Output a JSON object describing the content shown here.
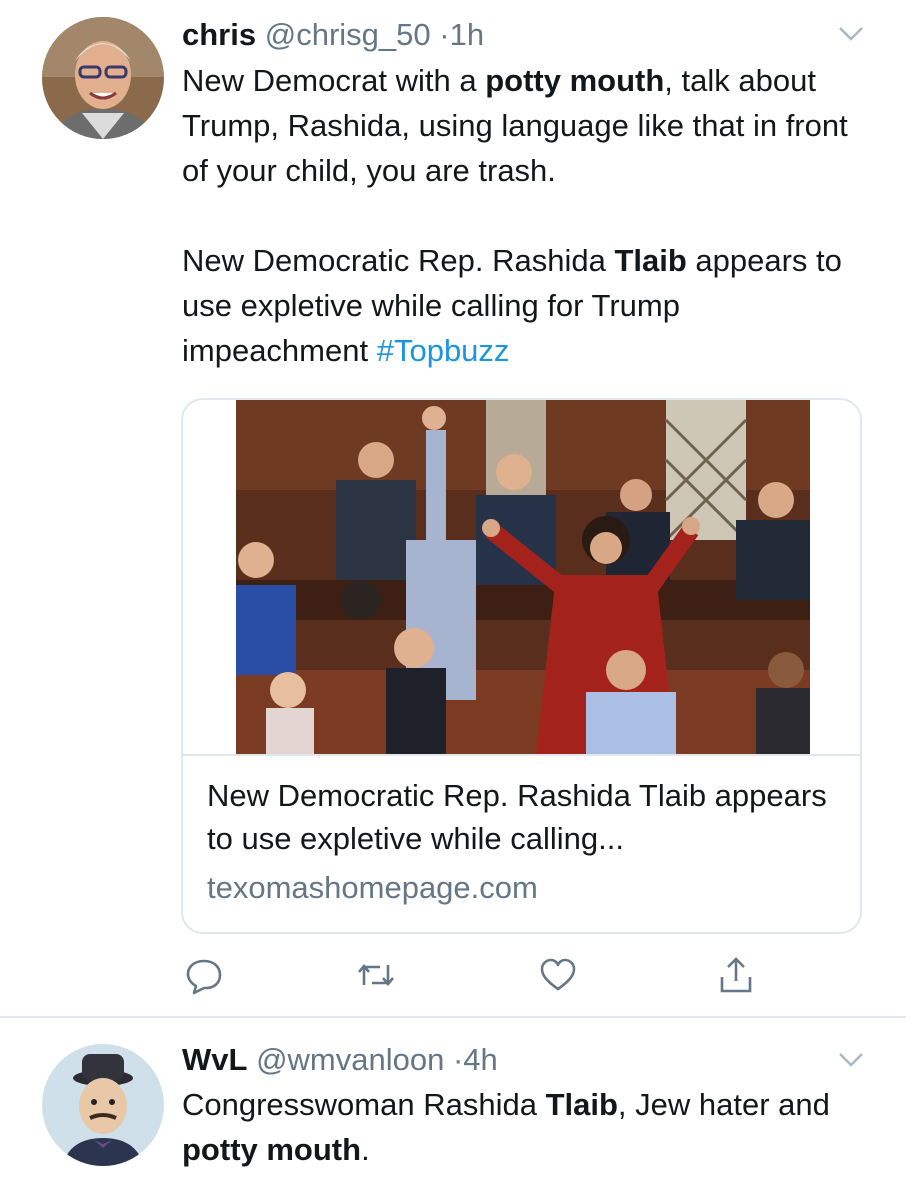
{
  "tweets": [
    {
      "name": "chris",
      "handle": "@chrisg_50",
      "time": "1h",
      "separator": "·",
      "body_p1": [
        {
          "text": "New Democrat with a ",
          "bold": false
        },
        {
          "text": "potty mouth",
          "bold": true
        },
        {
          "text": ", talk about Trump, Rashida, using language like that in front of your child, you are trash.",
          "bold": false
        }
      ],
      "body_p2": [
        {
          "text": "New Democratic Rep. Rashida ",
          "bold": false
        },
        {
          "text": "Tlaib",
          "bold": true
        },
        {
          "text": " appears to use expletive while calling for Trump impeachment ",
          "bold": false
        }
      ],
      "hashtag": "#Topbuzz",
      "card": {
        "title": "New Democratic Rep. Rashida Tlaib appears to use expletive while calling...",
        "domain": "texomashomepage.com"
      }
    },
    {
      "name": "WvL",
      "handle": "@wmvanloon",
      "time": "4h",
      "separator": "·",
      "body_parts": [
        {
          "text": "Congresswoman Rashida ",
          "bold": false
        },
        {
          "text": "Tlaib",
          "bold": true
        },
        {
          "text": ", Jew hater and ",
          "bold": false
        },
        {
          "text": "potty mouth",
          "bold": true
        },
        {
          "text": ".",
          "bold": false
        }
      ]
    }
  ],
  "colors": {
    "text": "#14171a",
    "secondary": "#657786",
    "link": "#1b95e0",
    "border": "#e1e8ed"
  },
  "icons": [
    "chevron-down-icon",
    "reply-icon",
    "retweet-icon",
    "like-icon",
    "share-icon"
  ]
}
